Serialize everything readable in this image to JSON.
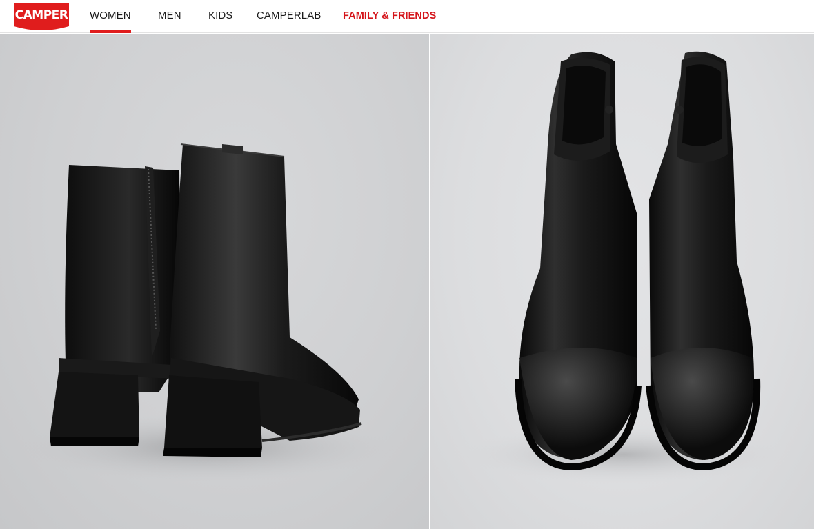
{
  "brand": {
    "logo_text": "CAMPER",
    "color": "#e01d1d"
  },
  "nav": {
    "items": [
      {
        "label": "WOMEN",
        "active": true
      },
      {
        "label": "MEN",
        "active": false
      },
      {
        "label": "KIDS",
        "active": false
      },
      {
        "label": "CAMPERLAB",
        "active": false
      },
      {
        "label": "FAMILY & FRIENDS",
        "active": false,
        "promo": true
      }
    ],
    "accent_color": "#e01d1d",
    "promo_color": "#d4141a"
  },
  "gallery": {
    "images": [
      {
        "subject": "black leather ankle boots, rear view",
        "icon": "product-photo-back"
      },
      {
        "subject": "black leather ankle boots, front top view",
        "icon": "product-photo-front"
      }
    ]
  }
}
